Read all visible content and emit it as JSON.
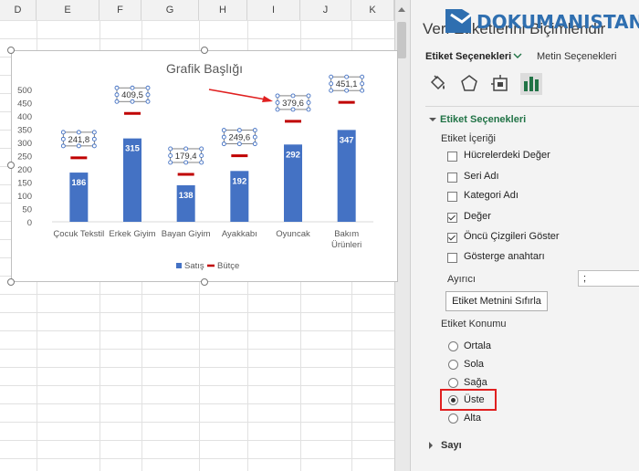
{
  "sheet": {
    "columns": [
      "D",
      "E",
      "F",
      "G",
      "H",
      "I",
      "J",
      "K"
    ]
  },
  "chart": {
    "title": "Grafik Başlığı",
    "y_ticks": [
      "500",
      "450",
      "400",
      "350",
      "300",
      "250",
      "200",
      "150",
      "100",
      "50",
      "0"
    ],
    "legend": {
      "bar": "Satış",
      "line": "Bütçe"
    },
    "colors": {
      "bar": "#4472c4",
      "line": "#c00000",
      "arrow": "#e02020"
    }
  },
  "chart_data": {
    "type": "bar",
    "title": "Grafik Başlığı",
    "categories": [
      "Çocuk Tekstil",
      "Erkek Giyim",
      "Bayan Giyim",
      "Ayakkabı",
      "Oyuncak",
      "Bakım Ürünleri"
    ],
    "ylim": [
      0,
      500
    ],
    "grid": false,
    "legend_position": "bottom",
    "series": [
      {
        "name": "Satış",
        "type": "bar",
        "values": [
          186,
          315,
          138,
          192,
          292,
          347
        ],
        "labels": [
          "186",
          "315",
          "138",
          "192",
          "292",
          "347"
        ]
      },
      {
        "name": "Bütçe",
        "type": "marker",
        "values": [
          241.8,
          409.5,
          179.4,
          249.6,
          379.6,
          451.1
        ],
        "labels": [
          "241,8",
          "409,5",
          "179,4",
          "249,6",
          "379,6",
          "451,1"
        ]
      }
    ]
  },
  "panel": {
    "title": "Veri Etiketlerini Biçimlendir",
    "logo_text": "DOKUMANISTAN",
    "tab_label_options": "Etiket Seçenekleri",
    "tab_text_options": "Metin Seçenekleri",
    "icons": [
      "fill-line-icon",
      "effects-icon",
      "size-properties-icon",
      "label-options-icon"
    ],
    "section_title": "Etiket Seçenekleri",
    "content_label": "Etiket İçeriği",
    "checkboxes": [
      {
        "label": "Hücrelerdeki Değer",
        "checked": false
      },
      {
        "label": "Seri Adı",
        "checked": false
      },
      {
        "label": "Kategori Adı",
        "checked": false
      },
      {
        "label": "Değer",
        "checked": true
      },
      {
        "label": "Öncü Çizgileri Göster",
        "checked": true
      },
      {
        "label": "Gösterge anahtarı",
        "checked": false
      }
    ],
    "separator_label": "Ayırıcı",
    "separator_value": ";",
    "reset_button": "Etiket Metnini Sıfırla",
    "position_label": "Etiket Konumu",
    "positions": [
      {
        "label": "Ortala",
        "selected": false
      },
      {
        "label": "Sola",
        "selected": false
      },
      {
        "label": "Sağa",
        "selected": false
      },
      {
        "label": "Üste",
        "selected": true
      },
      {
        "label": "Alta",
        "selected": false
      }
    ],
    "number_section": "Sayı"
  }
}
